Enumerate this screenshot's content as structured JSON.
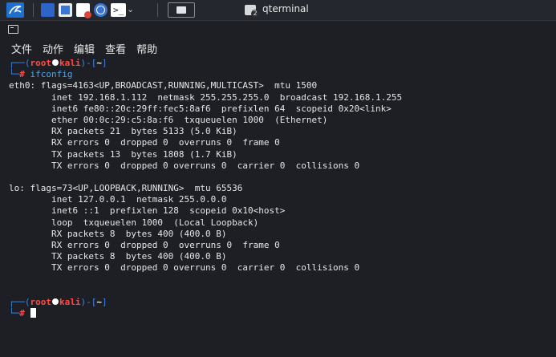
{
  "taskbar": {
    "task_title": "qterminal",
    "task_badge": "2",
    "terminal_glyph": ">_"
  },
  "menu": {
    "items": [
      "文件",
      "动作",
      "编辑",
      "查看",
      "帮助"
    ]
  },
  "prompt": {
    "user": "root",
    "host": "kali",
    "dir": "~",
    "symbol": "#"
  },
  "command": "ifconfig",
  "output": [
    "eth0: flags=4163<UP,BROADCAST,RUNNING,MULTICAST>  mtu 1500",
    "        inet 192.168.1.112  netmask 255.255.255.0  broadcast 192.168.1.255",
    "        inet6 fe80::20c:29ff:fec5:8af6  prefixlen 64  scopeid 0x20<link>",
    "        ether 00:0c:29:c5:8a:f6  txqueuelen 1000  (Ethernet)",
    "        RX packets 21  bytes 5133 (5.0 KiB)",
    "        RX errors 0  dropped 0  overruns 0  frame 0",
    "        TX packets 13  bytes 1808 (1.7 KiB)",
    "        TX errors 0  dropped 0 overruns 0  carrier 0  collisions 0",
    "",
    "lo: flags=73<UP,LOOPBACK,RUNNING>  mtu 65536",
    "        inet 127.0.0.1  netmask 255.0.0.0",
    "        inet6 ::1  prefixlen 128  scopeid 0x10<host>",
    "        loop  txqueuelen 1000  (Local Loopback)",
    "        RX packets 8  bytes 400 (400.0 B)",
    "        RX errors 0  dropped 0  overruns 0  frame 0",
    "        TX packets 8  bytes 400 (400.0 B)",
    "        TX errors 0  dropped 0 overruns 0  carrier 0  collisions 0",
    "",
    ""
  ],
  "colors": {
    "background": "#1d1f24",
    "prompt_bracket": "#3d86e6",
    "prompt_user": "#ff4b45",
    "command": "#4fa3e8",
    "text": "#e6e6e6"
  }
}
